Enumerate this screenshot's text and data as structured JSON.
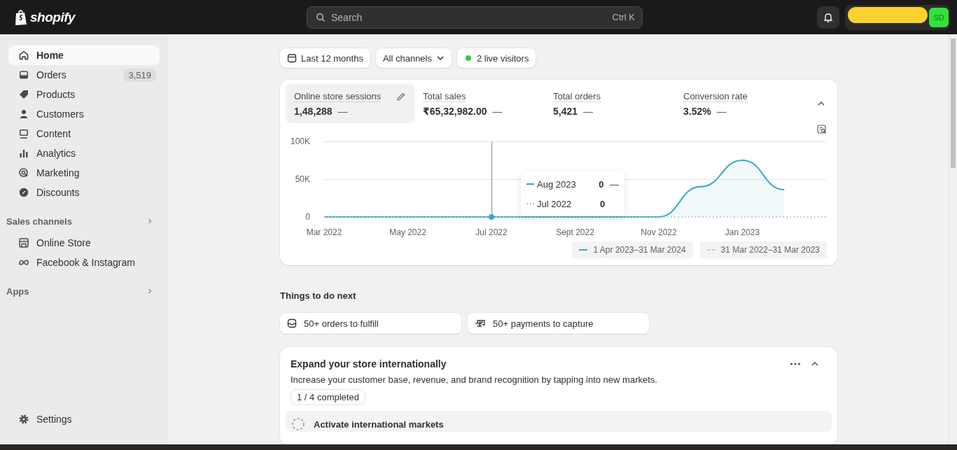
{
  "topbar": {
    "logo": "shopify",
    "search": {
      "placeholder": "Search",
      "shortcut": "Ctrl K"
    },
    "avatar": "SD"
  },
  "sidebar": {
    "items": [
      {
        "label": "Home",
        "selected": true
      },
      {
        "label": "Orders",
        "badge": "3,519",
        "selected": false
      },
      {
        "label": "Products",
        "selected": false
      },
      {
        "label": "Customers",
        "selected": false
      },
      {
        "label": "Content",
        "selected": false
      },
      {
        "label": "Analytics",
        "selected": false
      },
      {
        "label": "Marketing",
        "selected": false
      },
      {
        "label": "Discounts",
        "selected": false
      }
    ],
    "sections": [
      {
        "title": "Sales channels",
        "items": [
          {
            "label": "Online Store",
            "selected": false
          },
          {
            "label": "Facebook & Instagram",
            "selected": false
          }
        ]
      },
      {
        "title": "Apps"
      }
    ],
    "settings": "Settings"
  },
  "filters": [
    {
      "label": "Last 12 months",
      "kind": "date"
    },
    {
      "label": "All channels",
      "kind": "dropdown"
    },
    {
      "label": "2 live visitors",
      "kind": "live"
    }
  ],
  "metrics": [
    {
      "label": "Online store sessions",
      "value": "1,48,288",
      "trend": "—",
      "selected": true
    },
    {
      "label": "Total sales",
      "value": "₹65,32,982.00",
      "trend": "—",
      "selected": false
    },
    {
      "label": "Total orders",
      "value": "5,421",
      "trend": "—",
      "selected": false
    },
    {
      "label": "Conversion rate",
      "value": "3.52%",
      "trend": "—",
      "selected": false
    }
  ],
  "chart": {
    "chart_data": {
      "type": "line",
      "categories": [
        "Mar 2022",
        null,
        "May 2022",
        null,
        "Jul 2022",
        null,
        "Sept 2022",
        null,
        "Nov 2022",
        null,
        "Jan 2023",
        null,
        null
      ],
      "yticks": [
        {
          "value": 0,
          "label": "0"
        },
        {
          "value": 50000,
          "label": "50K"
        },
        {
          "value": 100000,
          "label": "100K"
        }
      ],
      "ylim": [
        0,
        100000
      ],
      "series": [
        {
          "name": "1 Apr 2023–31 Mar 2024",
          "color": "#36a8c9",
          "line_style": "solid",
          "values": [
            0,
            0,
            0,
            0,
            0,
            0,
            0,
            0,
            0,
            40000,
            75000,
            36000,
            null
          ]
        },
        {
          "name": "31 Mar 2022–31 Mar 2023",
          "color": "#8fcbe0",
          "line_style": "dotted",
          "values": [
            0,
            0,
            0,
            0,
            0,
            0,
            0,
            0,
            0,
            0,
            0,
            0,
            0
          ]
        }
      ]
    },
    "tooltip": {
      "rows": [
        {
          "label": "Aug 2023",
          "value": "0",
          "trend": "—",
          "kind": "solid"
        },
        {
          "label": "Jul 2022",
          "value": "0",
          "kind": "dotted"
        }
      ]
    }
  },
  "tasks": {
    "title": "Things to do next",
    "items": [
      {
        "label": "50+ orders to fulfill"
      },
      {
        "label": "50+ payments to capture"
      }
    ]
  },
  "setup_card": {
    "title": "Expand your store internationally",
    "description": "Increase your customer base, revenue, and brand recognition by tapping into new markets.",
    "progress": "1 / 4 completed",
    "steps": [
      {
        "label": "Activate international markets"
      }
    ]
  }
}
